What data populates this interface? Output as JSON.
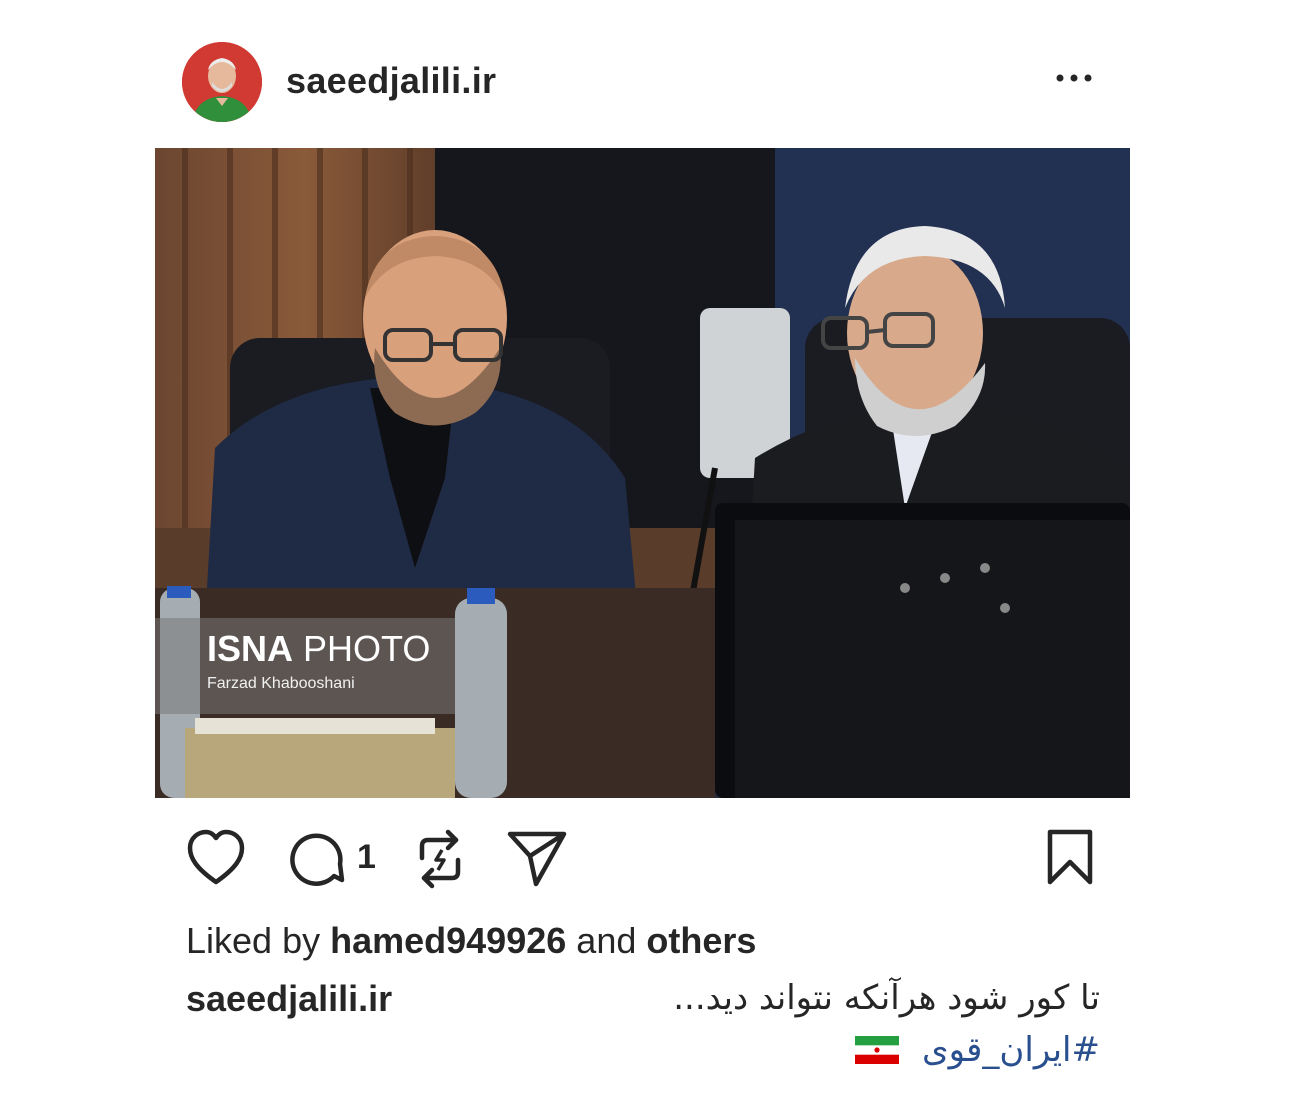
{
  "post": {
    "username": "saeedjalili.ir",
    "comment_count": "1",
    "liked_by_prefix": "Liked by",
    "liked_by_user": "hamed949926",
    "liked_by_and": "and",
    "liked_by_others": "others",
    "caption_user": "saeedjalili.ir",
    "caption_text": "تا کور شود هرآنکه نتواند دید...",
    "hashtag": "#ایران_قوی"
  },
  "photo": {
    "watermark_brand": "ISNA",
    "watermark_word": "PHOTO",
    "credit": "Farzad Khabooshani"
  },
  "icons": {
    "more": "more-horizontal-icon",
    "like": "heart-icon",
    "comment": "comment-icon",
    "repost": "repost-icon",
    "share": "send-icon",
    "save": "bookmark-icon",
    "flag": "iran-flag-icon"
  },
  "colors": {
    "text": "#262626",
    "hashtag": "#2a4f8f",
    "avatar_bg": "#c52a25"
  }
}
